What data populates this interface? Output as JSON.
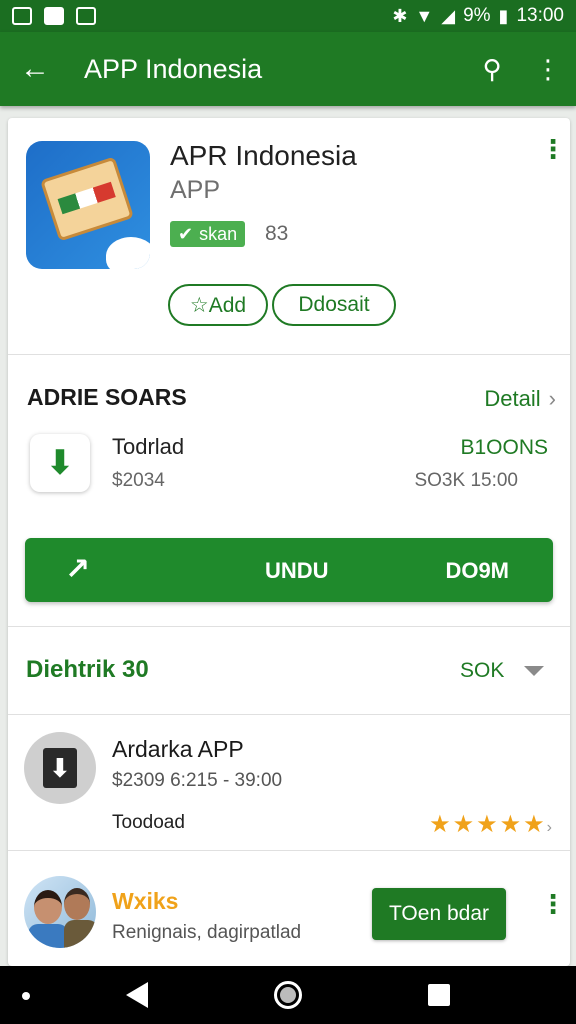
{
  "status_bar": {
    "battery": "9%",
    "time": "13:00"
  },
  "app_bar": {
    "title": "APP Indonesia"
  },
  "app": {
    "title": "APR Indonesia",
    "subtitle": "APP",
    "badge": "skan",
    "badge_count": "83",
    "buttons": {
      "add": "☆Add",
      "detail": "Ddosait"
    }
  },
  "section": {
    "title": "ADRIE SOARS",
    "link": "Detail"
  },
  "download": {
    "name": "Todrlad",
    "price": "$2034",
    "right_top": "B1OONS",
    "right_bottom": "SO3K 15:00"
  },
  "big_button": {
    "label_1": "UNDU",
    "label_2": "DO9M"
  },
  "filter": {
    "title": "Diehtrik 30",
    "value": "SOK"
  },
  "list_item": {
    "title": "Ardarka APP",
    "meta": "$2309  6:215 - 39:00",
    "footer": "Toodoad",
    "rating": 5
  },
  "review": {
    "title": "Wxiks",
    "subtitle": "Renignais, dagirpatlad",
    "button": "TOen bdar"
  },
  "icons": [
    "back-arrow-icon",
    "search-icon",
    "overflow-menu-icon",
    "download-arrow-icon",
    "pen-icon",
    "download-tray-icon",
    "star-icon",
    "chevron-right-icon",
    "caret-down-icon"
  ],
  "colors": {
    "primary": "#1f7a24",
    "accent_star": "#f0a21a",
    "badge": "#4caf50"
  }
}
